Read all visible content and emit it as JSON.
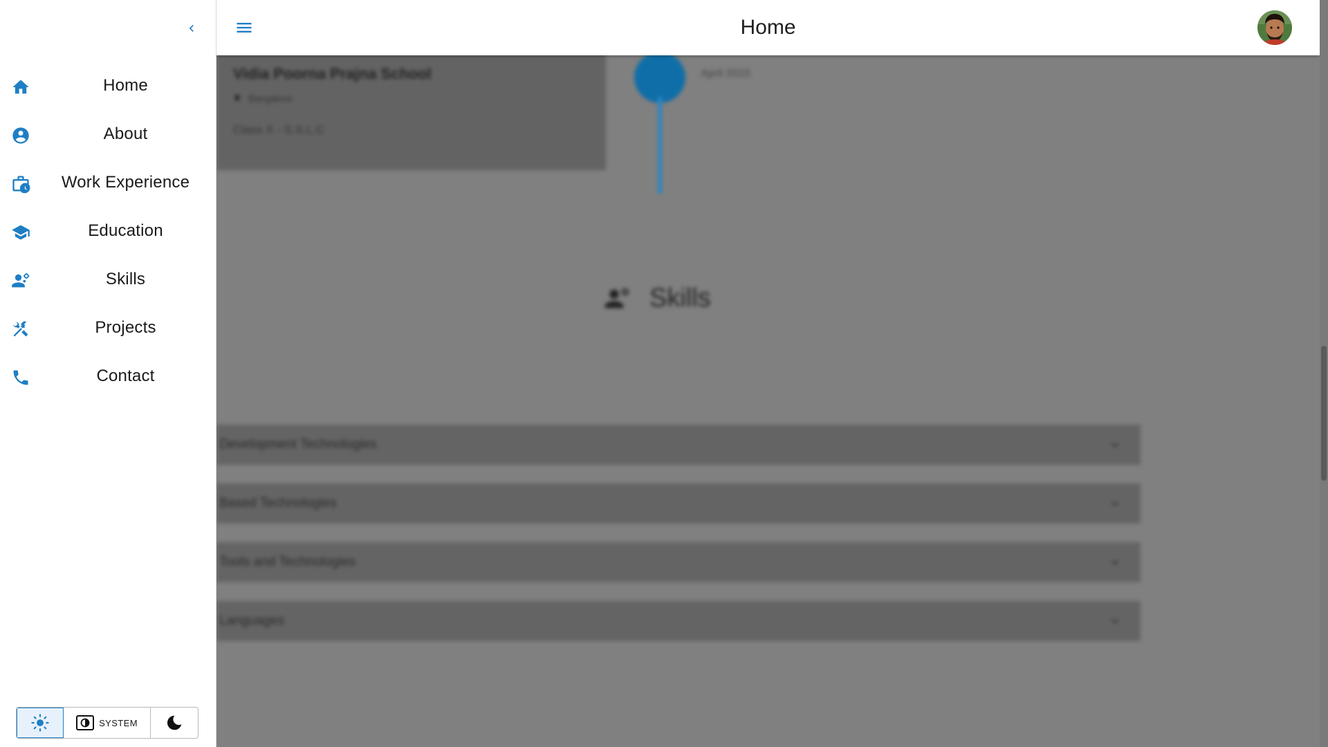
{
  "app": {
    "title": "Home",
    "accent_color": "#1f7fc4"
  },
  "sidebar": {
    "collapse_icon": "chevron-left-icon",
    "items": [
      {
        "label": "Home",
        "icon": "home-icon"
      },
      {
        "label": "About",
        "icon": "account-circle-icon"
      },
      {
        "label": "Work Experience",
        "icon": "work-history-icon"
      },
      {
        "label": "Education",
        "icon": "school-icon"
      },
      {
        "label": "Skills",
        "icon": "skills-icon"
      },
      {
        "label": "Projects",
        "icon": "tools-icon"
      },
      {
        "label": "Contact",
        "icon": "phone-icon"
      }
    ],
    "theme_toggle": {
      "light_icon": "sun-icon",
      "system_label": "SYSTEM",
      "system_icon": "contrast-icon",
      "dark_icon": "moon-icon",
      "selected": "light"
    }
  },
  "appbar": {
    "menu_icon": "menu-icon",
    "avatar_icon": "avatar"
  },
  "main": {
    "education": {
      "school": "Vidia Poorna Prajna School",
      "location": "Bangalore",
      "class": "Class X - S.S.L.C",
      "date": "April 2015"
    },
    "skills_heading": "Skills",
    "skill_categories": [
      "Development Technologies",
      "Based Technologies",
      "Tools and Technologies",
      "Languages"
    ]
  }
}
